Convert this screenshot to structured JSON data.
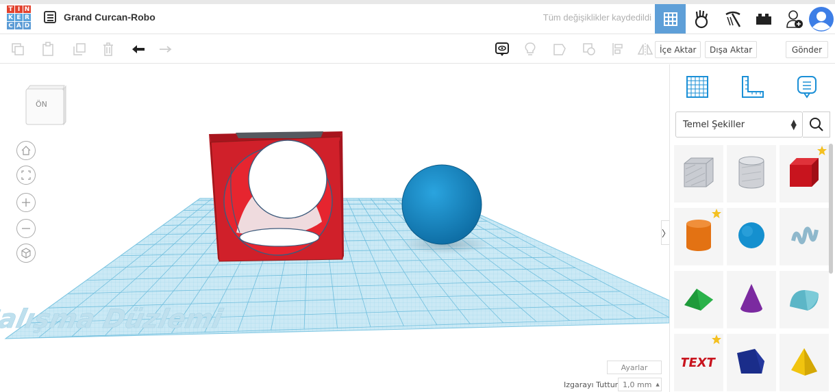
{
  "app": {
    "logo_letters": [
      "T",
      "I",
      "N",
      "K",
      "E",
      "R",
      "C",
      "A",
      "D"
    ],
    "logo_colors": [
      "#e2422e",
      "#e2422e",
      "#e2422e",
      "#59a3dc",
      "#59a3dc",
      "#59a3dc",
      "#5b9bd5",
      "#5b9bd5",
      "#5b9bd5"
    ],
    "design_title": "Grand Curcan-Robo",
    "save_status": "Tüm değişiklikler kaydedildi"
  },
  "topbar": {
    "icons": [
      "grid-view-icon",
      "blocks-hand-icon",
      "bricks-pickaxe-icon",
      "lego-brick-icon",
      "add-user-icon",
      "avatar"
    ]
  },
  "toolbar": {
    "import_label": "İçe Aktar",
    "export_label": "Dışa Aktar",
    "send_label": "Gönder"
  },
  "viewport": {
    "viewcube_label": "ÖN",
    "workplane_label": "Çalışma Düzlemi",
    "settings_label": "Ayarlar",
    "snap_label": "Izgarayı Tuttur",
    "snap_value": "1,0 mm"
  },
  "panel": {
    "library_label": "Temel Şekiller",
    "shapes": [
      {
        "name": "box-hole",
        "starred": false
      },
      {
        "name": "cylinder-hole",
        "starred": false
      },
      {
        "name": "box",
        "starred": true
      },
      {
        "name": "cylinder",
        "starred": true
      },
      {
        "name": "sphere",
        "starred": false
      },
      {
        "name": "scribble",
        "starred": false
      },
      {
        "name": "roof",
        "starred": false
      },
      {
        "name": "cone",
        "starred": false
      },
      {
        "name": "round-roof",
        "starred": false
      },
      {
        "name": "text",
        "starred": true
      },
      {
        "name": "polygon",
        "starred": false
      },
      {
        "name": "pyramid",
        "starred": false
      }
    ]
  },
  "colors": {
    "accent": "#5e9fd8",
    "box_red": "#d0202a",
    "sphere_blue": "#1e88c4",
    "grid_blue": "#8fcde8"
  }
}
